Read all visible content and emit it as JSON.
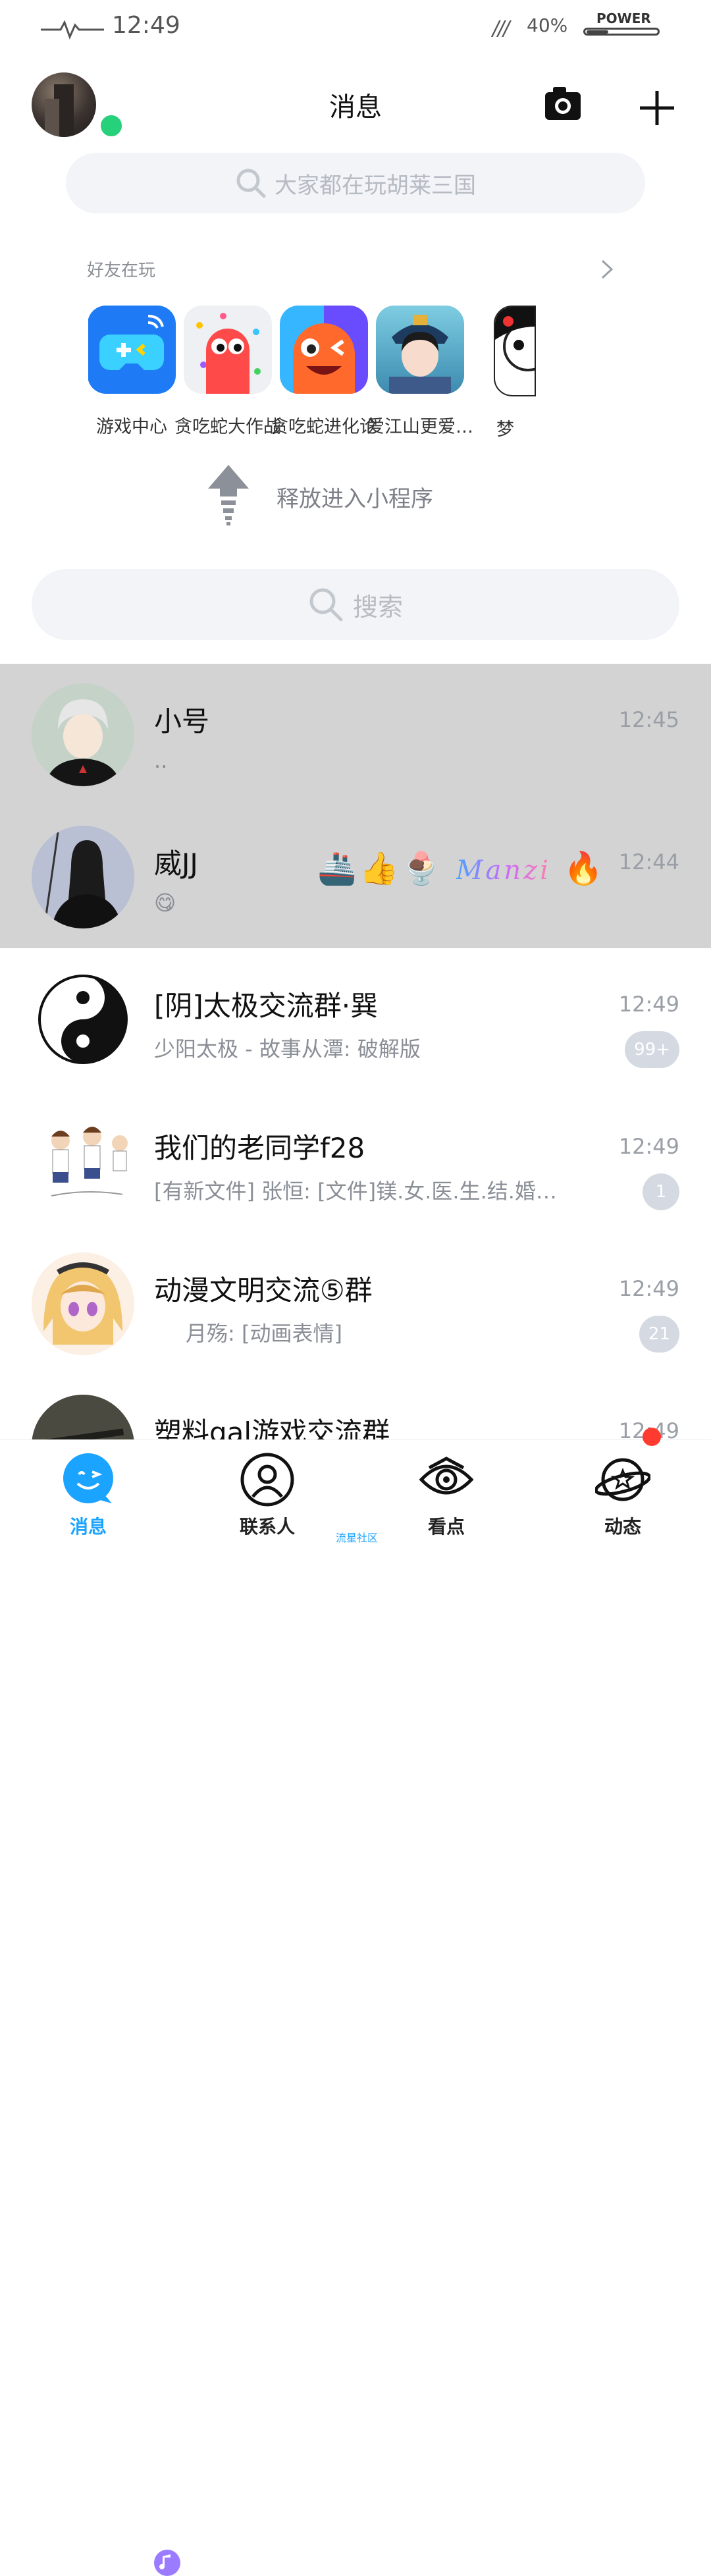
{
  "status_bar": {
    "time": "12:49",
    "battery_percent": "40%",
    "battery_label": "POWER",
    "battery_level": 0.3,
    "signal": "///"
  },
  "header": {
    "title": "消息"
  },
  "program_search": {
    "placeholder": "大家都在玩胡莱三国"
  },
  "friends_playing": {
    "label": "好友在玩",
    "apps": [
      {
        "label": "游戏中心",
        "icon": "game-center-icon"
      },
      {
        "label": "贪吃蛇大作战",
        "icon": "snake-battle-icon"
      },
      {
        "label": "贪吃蛇进化论",
        "icon": "snake-evolution-icon"
      },
      {
        "label": "爱江山更爱…",
        "icon": "palace-game-icon"
      },
      {
        "label": "梦",
        "icon": "dream-game-icon"
      }
    ]
  },
  "release_hint": {
    "text": "释放进入小程序"
  },
  "search": {
    "placeholder": "搜索"
  },
  "chats": [
    {
      "name": "小号",
      "preview": "..",
      "time": "12:45",
      "pinned": true
    },
    {
      "name": "威JJ",
      "preview": "😋",
      "time": "12:44",
      "pinned": true,
      "tags": "🚢👍🍨",
      "tag_text": "Manzi",
      "tag_fire": "🔥"
    },
    {
      "name": "[阴]太极交流群·巽",
      "preview": "少阳太极 - 故事从潭: 破解版",
      "time": "12:49",
      "badge": "99+"
    },
    {
      "name": "我们的老同学f28",
      "preview": "[有新文件] 张恒: [文件]镁.女.医.生.结.婚…",
      "time": "12:49",
      "badge": "1"
    },
    {
      "name": "动漫文明交流⑤群",
      "preview": "月殇: [动画表情]",
      "time": "12:49",
      "badge": "21"
    },
    {
      "name": "塑料gal游戏交流群",
      "preview": "",
      "time": "12:49"
    }
  ],
  "bottom_nav": {
    "items": [
      {
        "label": "消息",
        "active": true
      },
      {
        "label": "联系人",
        "active": false
      },
      {
        "label": "看点",
        "active": false
      },
      {
        "label": "动态",
        "active": false
      }
    ],
    "sub_label": "流星社区"
  },
  "colors": {
    "accent": "#1aa3ff",
    "online": "#27d07a",
    "badge": "#d4d9e2",
    "pinned_bg": "#d3d3d3",
    "notify": "#ff3b30"
  }
}
